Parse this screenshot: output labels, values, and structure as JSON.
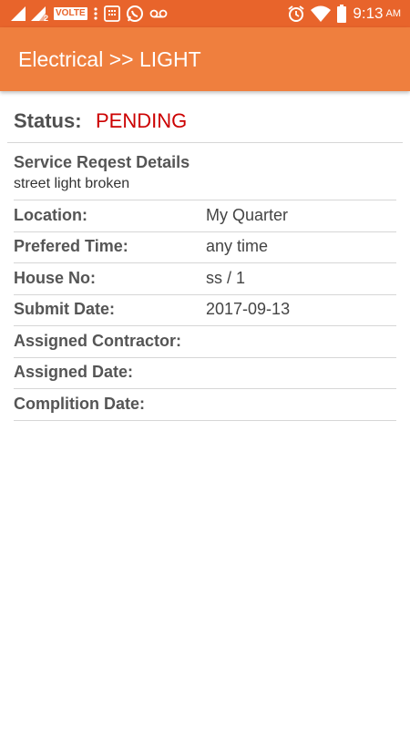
{
  "status_bar": {
    "volte": "VOLTE",
    "sim2": "2",
    "time": "9:13",
    "ampm": "AM"
  },
  "toolbar": {
    "title": "Electrical >> LIGHT"
  },
  "status": {
    "label": "Status:",
    "value": "PENDING",
    "value_color": "#cc0000"
  },
  "details": {
    "title": "Service Reqest Details",
    "text": "street light broken"
  },
  "fields": [
    {
      "label": "Location:",
      "value": "My Quarter"
    },
    {
      "label": "Prefered Time:",
      "value": "any time"
    },
    {
      "label": "House No:",
      "value": "ss / 1"
    },
    {
      "label": "Submit Date:",
      "value": "2017-09-13"
    },
    {
      "label": "Assigned Contractor:",
      "value": ""
    },
    {
      "label": "Assigned Date:",
      "value": ""
    },
    {
      "label": "Complition Date:",
      "value": ""
    }
  ],
  "colors": {
    "status_bar": "#e8642b",
    "toolbar": "#ef7f3e"
  }
}
